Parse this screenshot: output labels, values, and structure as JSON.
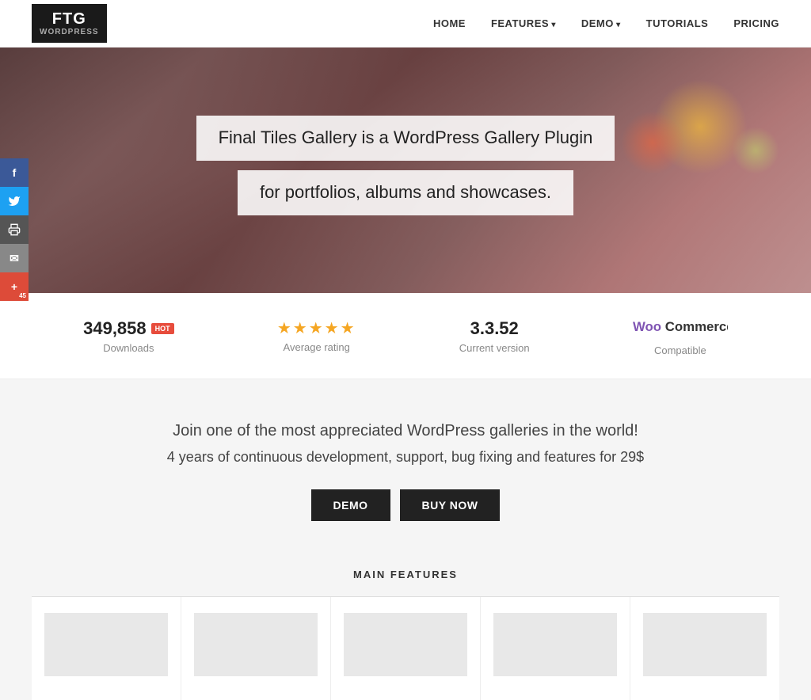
{
  "nav": {
    "logo_line1": "FTG",
    "logo_line2": "WORDPRESS",
    "links": [
      {
        "label": "HOME",
        "has_arrow": false
      },
      {
        "label": "FEATURES",
        "has_arrow": true
      },
      {
        "label": "DEMO",
        "has_arrow": true
      },
      {
        "label": "TUTORIALS",
        "has_arrow": false
      },
      {
        "label": "PRICING",
        "has_arrow": false
      }
    ]
  },
  "social": [
    {
      "icon": "f",
      "type": "fb",
      "label": "Facebook"
    },
    {
      "icon": "t",
      "type": "tw",
      "label": "Twitter"
    },
    {
      "icon": "⊟",
      "type": "print",
      "label": "Print"
    },
    {
      "icon": "✉",
      "type": "email",
      "label": "Email"
    },
    {
      "icon": "+",
      "type": "plus",
      "count": "45",
      "label": "Plus"
    }
  ],
  "hero": {
    "line1": "Final Tiles Gallery is a WordPress Gallery Plugin",
    "line2": "for portfolios, albums and showcases."
  },
  "stats": [
    {
      "value": "349,858",
      "badge": "hot",
      "label": "Downloads"
    },
    {
      "stars": "★★★★★",
      "label": "Average rating"
    },
    {
      "value": "3.3.52",
      "label": "Current version"
    },
    {
      "woo": "WooCommerce",
      "label": "Compatible"
    }
  ],
  "promo": {
    "line1": "Join one of the most appreciated WordPress galleries in the world!",
    "line2": "4 years of continuous development, support, bug fixing and features for 29$",
    "btn1": "DEMO",
    "btn2": "BUY NOW"
  },
  "features": {
    "title": "MAIN FEATURES"
  }
}
